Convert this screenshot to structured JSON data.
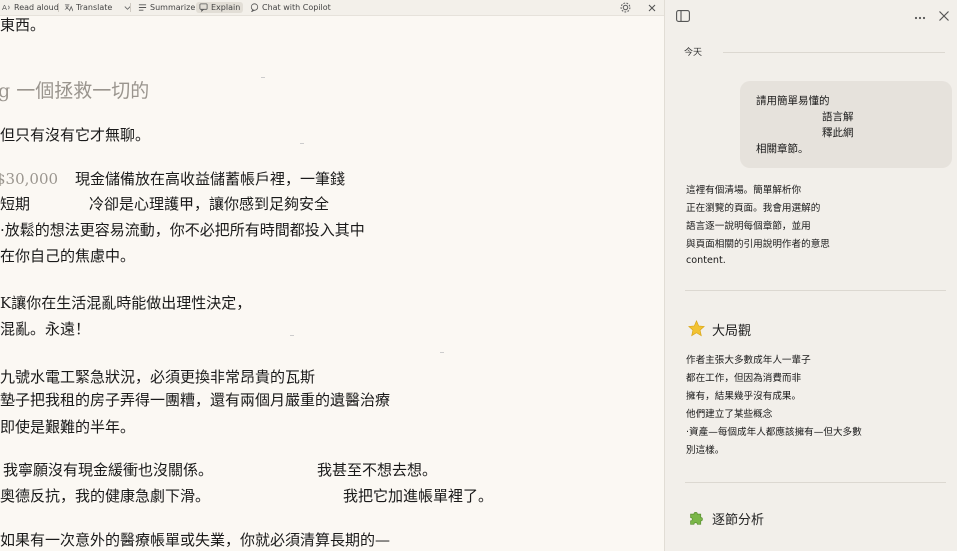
{
  "toolbar": {
    "read_aloud": "Read aloud",
    "translate": "Translate",
    "summarize": "Summarize",
    "explain": "Explain",
    "chat": "Chat with Copilot"
  },
  "article": {
    "lines": [
      "東西。",
      "g 一個拯救一切的",
      "但只有沒有它才無聊。",
      "$30,000",
      "現金儲備放在高收益儲蓄帳戶裡，一筆錢",
      "短期",
      "冷卻是心理護甲，讓你感到足夠安全",
      "·放鬆的想法更容易流動，你不必把所有時間都投入其中",
      "在你自己的焦慮中。",
      "K讓你在生活混亂時能做出理性決定，",
      "混亂。永遠！",
      "九號水電工緊急狀況，必須更換非常昂貴的瓦斯",
      "墊子把我租的房子弄得一團糟，還有兩個月嚴重的遺醫治療",
      "即使是艱難的半年。",
      "我寧願沒有現金緩衝也沒關係。",
      "我甚至不想去想。",
      "奧德反抗，我的健康急劇下滑。",
      "我把它加進帳單裡了。",
      "如果有一次意外的醫療帳單或失業，你就必須清算長期的—"
    ]
  },
  "panel": {
    "today": "今天",
    "user_message": [
      "請用簡單易懂的",
      "語言解",
      "釋此網",
      "相關章節。"
    ],
    "reply": [
      "這裡有個清場。簡單解析你",
      "正在瀏覽的頁面。我會用選解的",
      "語言逐一說明每個章節，並用",
      "與頁面相關的引用說明作者的意思",
      "content."
    ],
    "big_picture": {
      "icon": "star-icon",
      "title": "大局觀",
      "lines": [
        "作者主張大多數成年人一輩子",
        "都在工作，但因為消費而非",
        "擁有，結果幾乎沒有成果。",
        "他們建立了某些概念",
        "·資產—每個成年人都應該擁有—但大多數",
        "別這樣。"
      ]
    },
    "section_breakdown": {
      "icon": "puzzle-icon",
      "title": "逐節分析"
    }
  },
  "colors": {
    "reader_bg": "#fbf8f3",
    "panel_bg": "#f2efea",
    "bubble_bg": "#e6e2dc",
    "star": "#f2c232",
    "puzzle": "#7ab648"
  }
}
